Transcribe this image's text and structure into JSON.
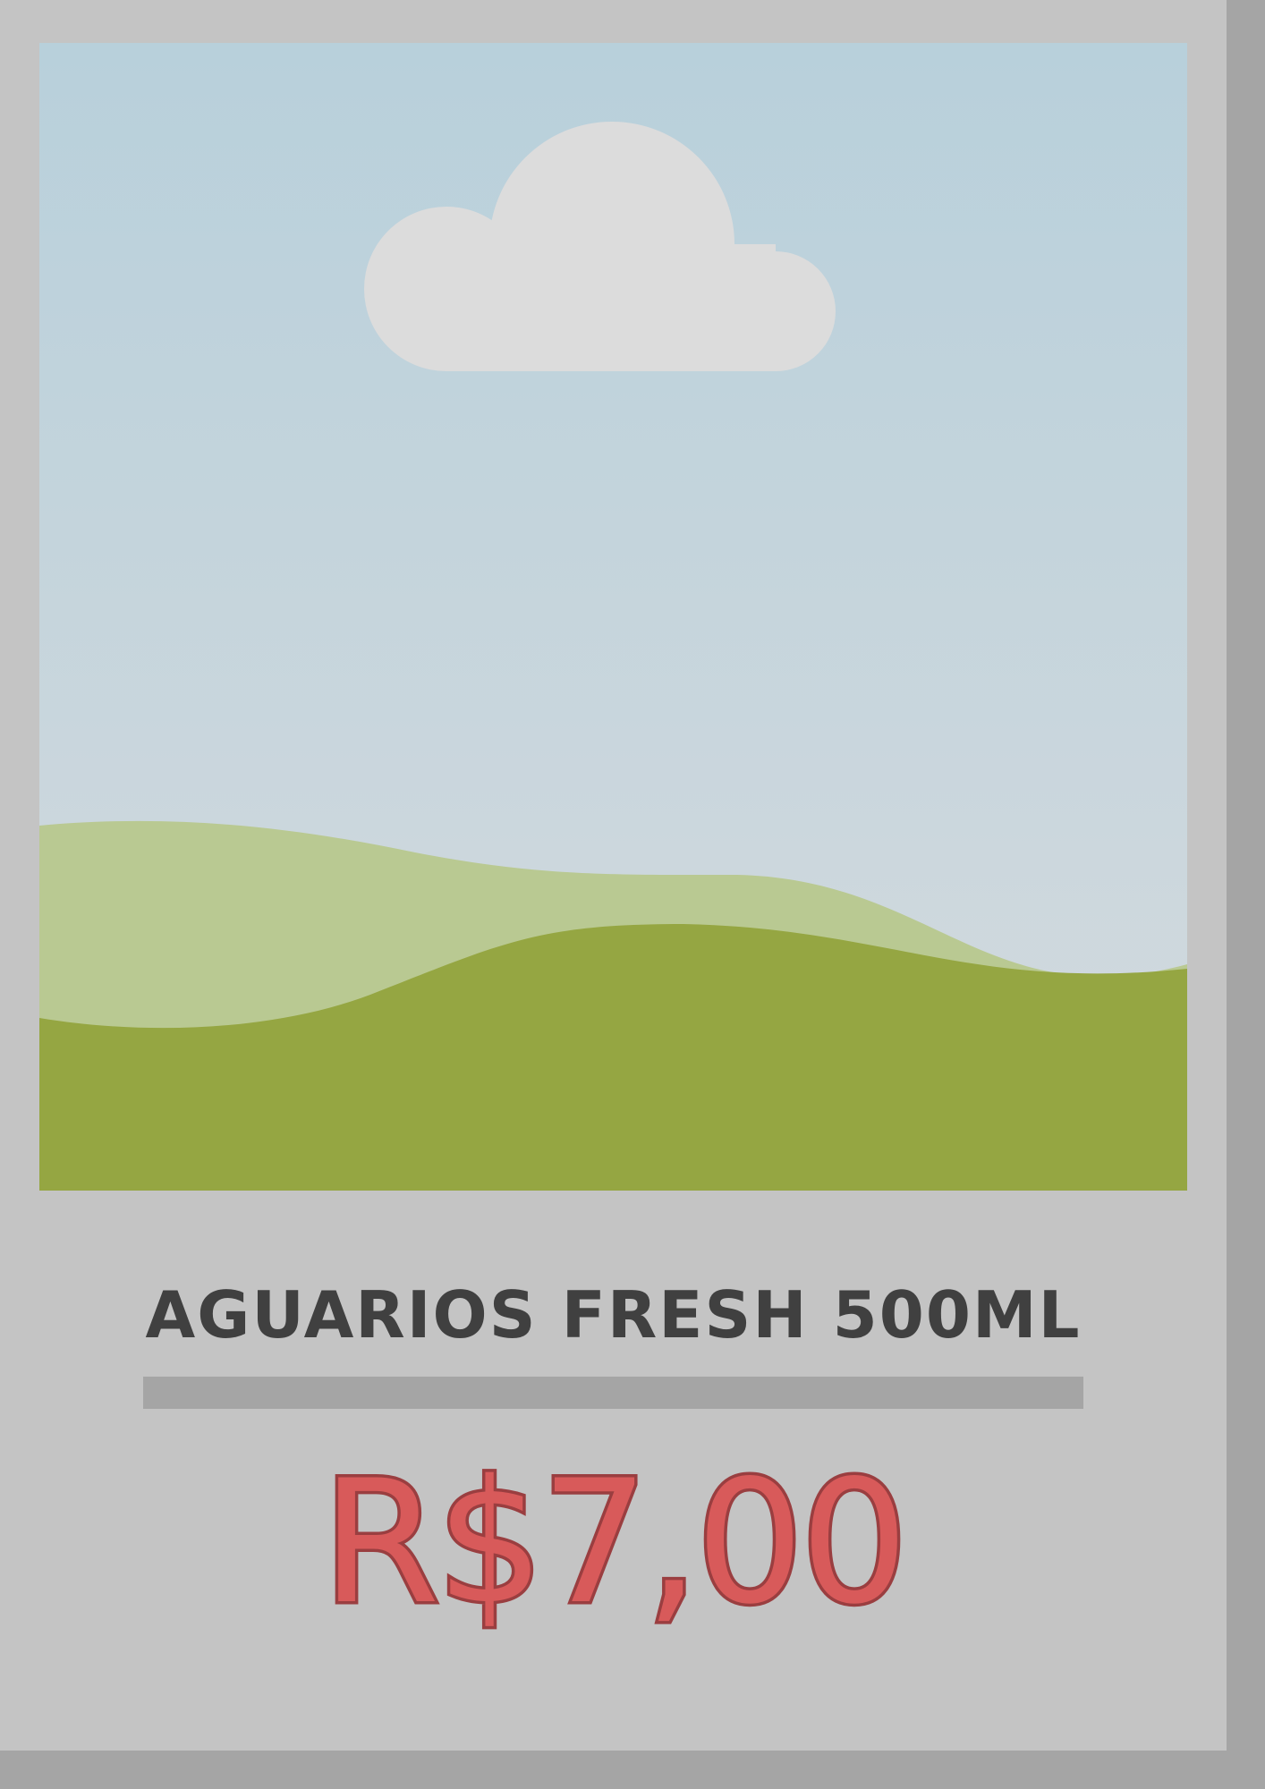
{
  "product": {
    "image_icon": "landscape-placeholder-icon",
    "name": "AGUARIOS FRESH 500ML",
    "price": "R$7,00"
  },
  "colors": {
    "background": "#c4c4c4",
    "shadow": "#a5a5a5",
    "sky_top": "#b8d0db",
    "sky_bottom": "#d4dade",
    "cloud": "#dcdcdc",
    "hill_back": "#b9c992",
    "hill_front": "#95a642",
    "name_text": "#404040",
    "price_fill": "#d85a5a",
    "price_stroke": "#9a3e40"
  }
}
